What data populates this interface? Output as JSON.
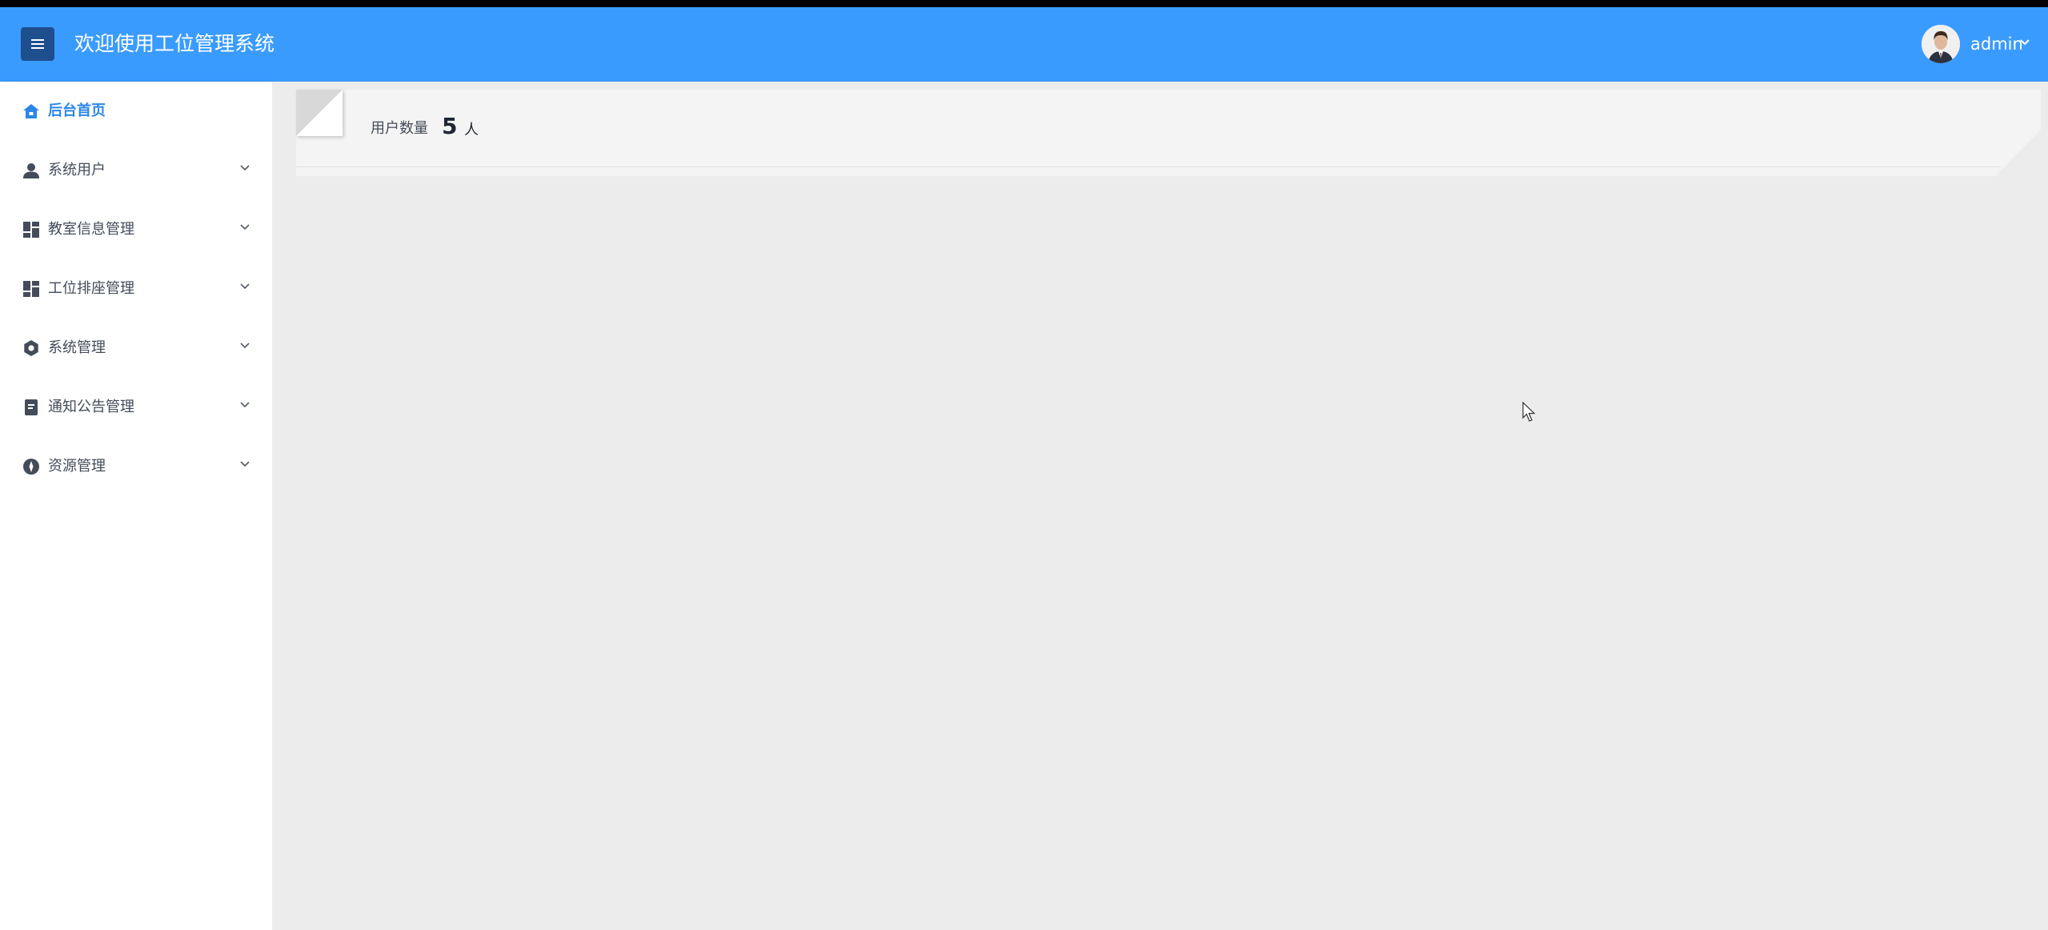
{
  "header": {
    "title": "欢迎使用工位管理系统",
    "user_name": "admin",
    "menu_icon": "hamburger-icon",
    "caret_icon": "chevron-down-icon",
    "bg_color": "#3a9bff",
    "menu_btn_color": "#1e4e8e"
  },
  "sidebar": {
    "items": [
      {
        "label": "后台首页",
        "icon": "home-icon",
        "active": true
      },
      {
        "label": "系统用户",
        "icon": "user-icon"
      },
      {
        "label": "教室信息管理",
        "icon": "dashboard-icon"
      },
      {
        "label": "工位排座管理",
        "icon": "dashboard-icon"
      },
      {
        "label": "系统管理",
        "icon": "settings-icon"
      },
      {
        "label": "通知公告管理",
        "icon": "document-icon"
      },
      {
        "label": "资源管理",
        "icon": "compass-icon"
      }
    ],
    "active_color": "#2b86e8"
  },
  "stats": {
    "user_count_label": "用户数量",
    "user_count_value": "5",
    "user_count_unit": "人"
  }
}
